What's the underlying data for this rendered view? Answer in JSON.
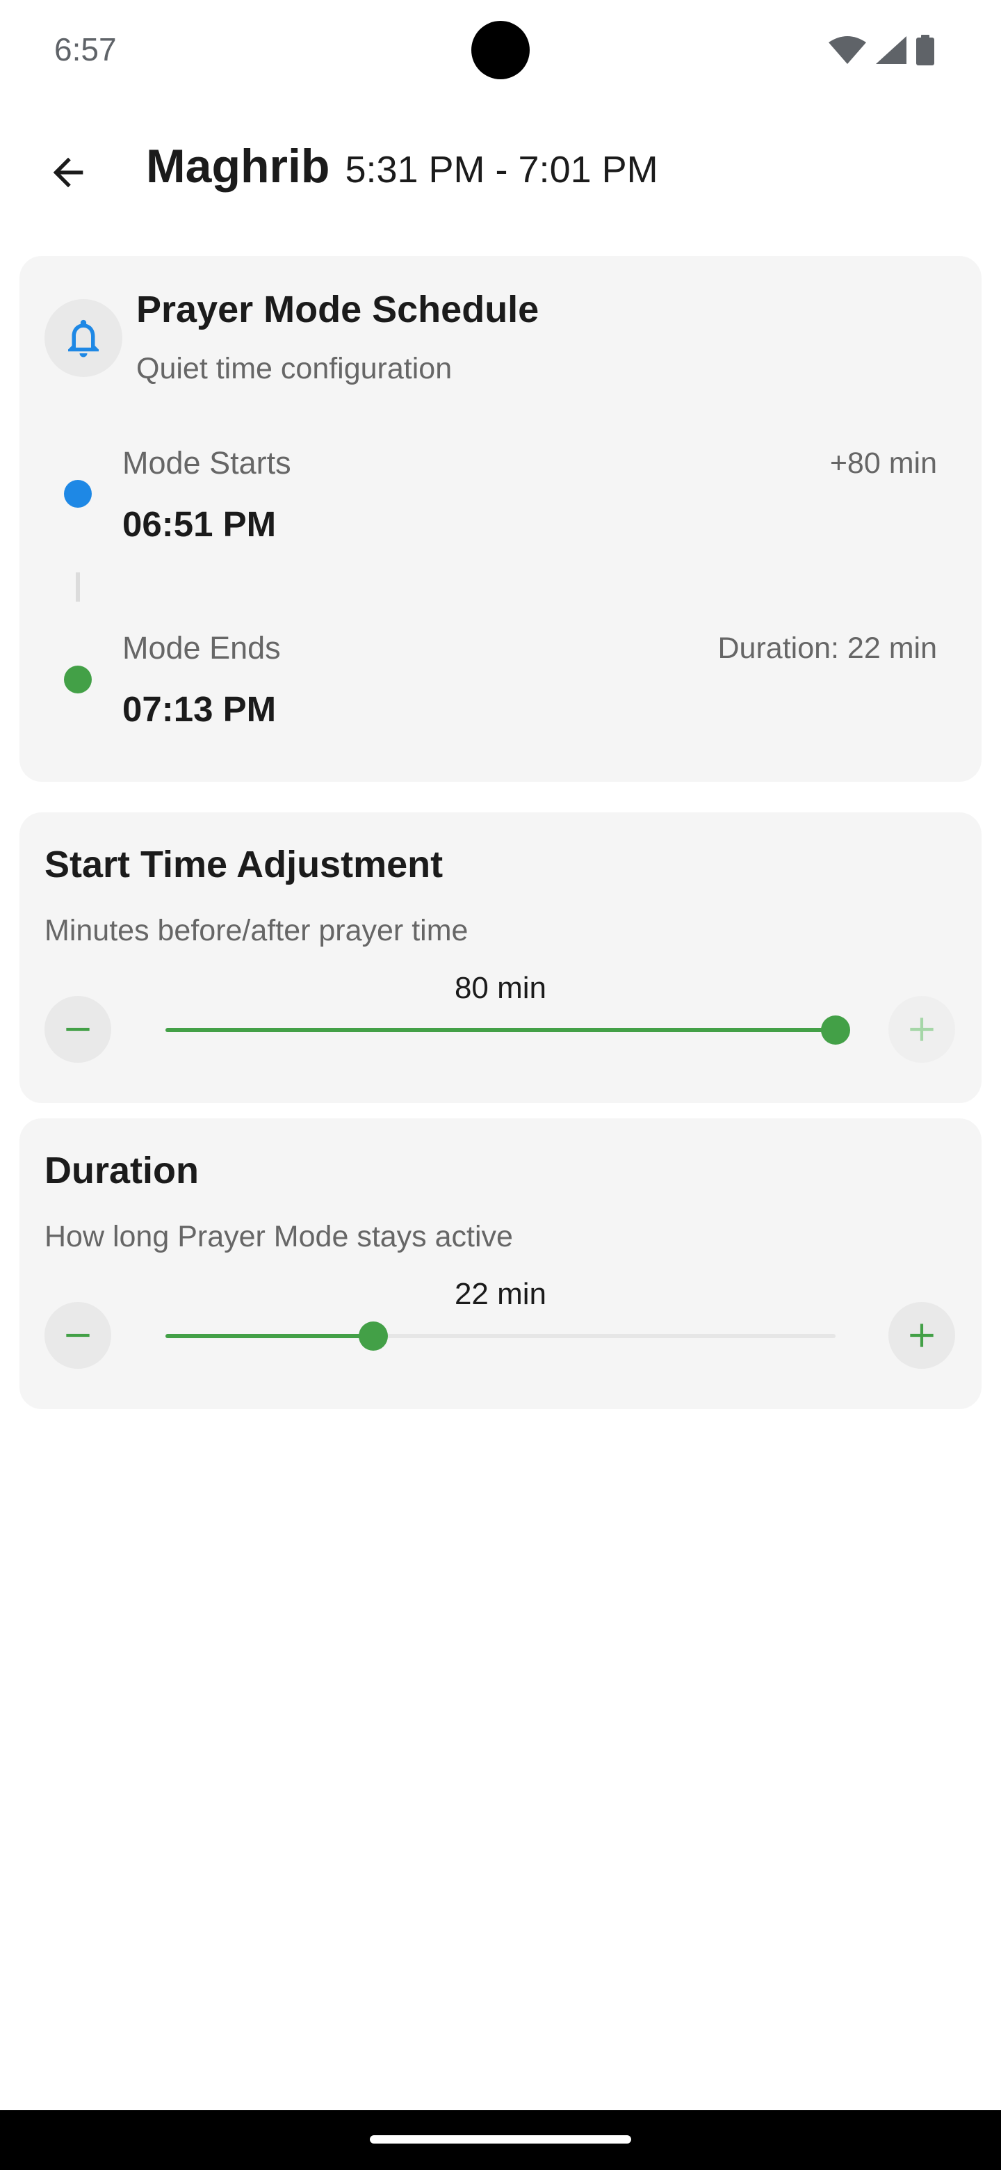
{
  "status_bar": {
    "time": "6:57",
    "icons": [
      "wifi-icon",
      "cellular-signal-icon",
      "battery-icon"
    ]
  },
  "header": {
    "back_icon": "arrow-back-icon",
    "prayer_name": "Maghrib",
    "time_range": "5:31 PM - 7:01 PM"
  },
  "schedule": {
    "icon": "bell-icon",
    "title": "Prayer Mode Schedule",
    "subtitle": "Quiet time configuration",
    "start": {
      "label": "Mode Starts",
      "time": "06:51 PM",
      "offset": "+80 min"
    },
    "end": {
      "label": "Mode Ends",
      "time": "07:13 PM",
      "duration": "Duration: 22 min"
    }
  },
  "start_adjustment": {
    "title": "Start Time Adjustment",
    "subtitle": "Minutes before/after prayer time",
    "value_label": "80 min",
    "value": 80,
    "fraction": 1.0,
    "minus_icon": "minus-icon",
    "plus_icon": "plus-icon",
    "plus_enabled": false
  },
  "duration": {
    "title": "Duration",
    "subtitle": "How long Prayer Mode stays active",
    "value_label": "22 min",
    "value": 22,
    "fraction": 0.31,
    "minus_icon": "minus-icon",
    "plus_icon": "plus-icon",
    "plus_enabled": true
  },
  "colors": {
    "accent_green": "#43a047",
    "accent_blue": "#1e88e5",
    "card_bg": "#f5f5f5"
  }
}
